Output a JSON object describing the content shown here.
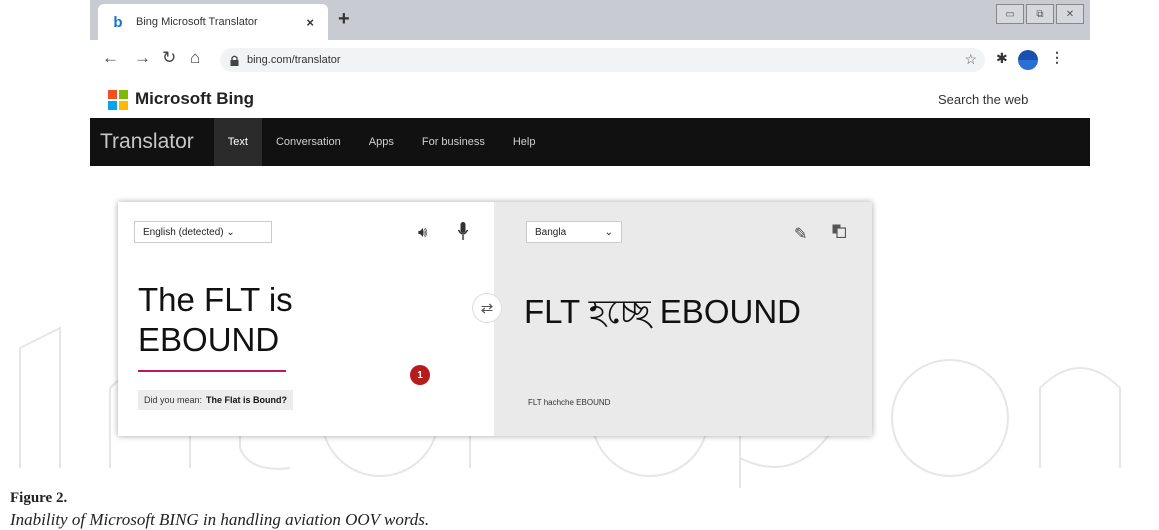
{
  "browser": {
    "tab_title": "Bing Microsoft Translator",
    "tab_close": "×",
    "new_tab": "+",
    "url": "bing.com/translator",
    "window_controls": [
      "▭",
      "⧉",
      "✕"
    ]
  },
  "bing": {
    "brand": "Microsoft Bing",
    "search_link": "Search the web"
  },
  "translator_nav": {
    "title": "Translator",
    "items": [
      {
        "label": "Text",
        "active": true
      },
      {
        "label": "Conversation",
        "active": false
      },
      {
        "label": "Apps",
        "active": false
      },
      {
        "label": "For business",
        "active": false
      },
      {
        "label": "Help",
        "active": false
      }
    ]
  },
  "source": {
    "language": "English (detected) ⌄",
    "text_line1": "The FLT is",
    "text_line2": "EBOUND",
    "error_count": "1",
    "suggestion_prefix": "Did you mean:",
    "suggestion": "The Flat is Bound?"
  },
  "target": {
    "language": "Bangla",
    "text": "FLT হচ্ছে EBOUND",
    "transliteration": "FLT hachche EBOUND"
  },
  "colors": {
    "nav_bg": "#111111",
    "error_underline": "#c2185b",
    "badge": "#b71c1c",
    "target_pane": "#eaeaea"
  },
  "caption": {
    "label": "Figure 2.",
    "text": "Inability of Microsoft BING in handling aviation OOV words."
  }
}
